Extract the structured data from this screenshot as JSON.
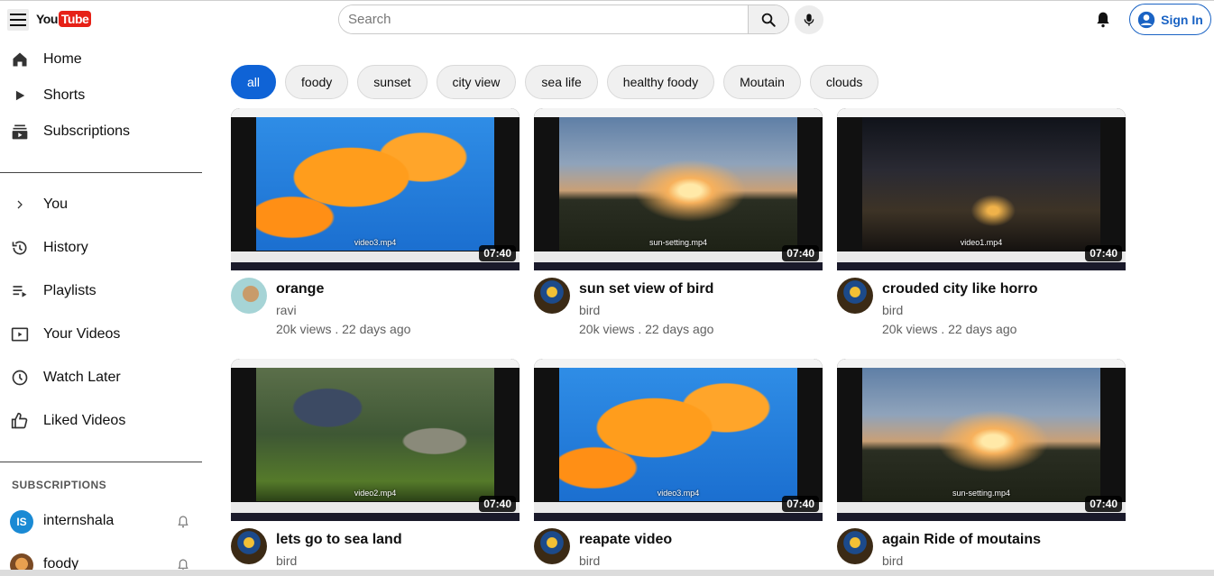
{
  "header": {
    "logo_you": "You",
    "logo_tube": "Tube",
    "search_placeholder": "Search",
    "signin_label": "Sign In"
  },
  "sidebar": {
    "main": [
      {
        "label": "Home",
        "icon": "home-icon"
      },
      {
        "label": "Shorts",
        "icon": "play-icon"
      },
      {
        "label": "Subscriptions",
        "icon": "subscriptions-icon"
      }
    ],
    "you": [
      {
        "label": "You",
        "icon": "chevron-right-icon"
      },
      {
        "label": "History",
        "icon": "history-icon"
      },
      {
        "label": "Playlists",
        "icon": "playlist-icon"
      },
      {
        "label": "Your Videos",
        "icon": "video-icon"
      },
      {
        "label": "Watch Later",
        "icon": "clock-icon"
      },
      {
        "label": "Liked Videos",
        "icon": "thumbs-up-icon"
      }
    ],
    "subscriptions_heading": "SUBSCRIPTIONS",
    "subscriptions": [
      {
        "name": "internshala",
        "initials": "IS",
        "color": "#1a8ad4"
      },
      {
        "name": "foody",
        "initials": "",
        "color": "#c98a4a"
      }
    ]
  },
  "chips": [
    "all",
    "foody",
    "sunset",
    "city view",
    "sea life",
    "healthy foody",
    "Moutain",
    "clouds"
  ],
  "videos": [
    {
      "title": "orange",
      "channel": "ravi",
      "stats": "20k views . 22 days ago",
      "duration": "07:40",
      "file": "video3.mp4"
    },
    {
      "title": "sun set view of bird",
      "channel": "bird",
      "stats": "20k views . 22 days ago",
      "duration": "07:40",
      "file": "sun-setting.mp4"
    },
    {
      "title": "crouded city like horro",
      "channel": "bird",
      "stats": "20k views . 22 days ago",
      "duration": "07:40",
      "file": "video1.mp4"
    },
    {
      "title": "lets go to sea land",
      "channel": "bird",
      "stats": "",
      "duration": "07:40",
      "file": "video2.mp4"
    },
    {
      "title": "reapate video",
      "channel": "bird",
      "stats": "",
      "duration": "07:40",
      "file": "video3.mp4"
    },
    {
      "title": "again Ride of moutains",
      "channel": "bird",
      "stats": "",
      "duration": "07:40",
      "file": "sun-setting.mp4"
    }
  ],
  "colors": {
    "accent": "#0f63d6",
    "signin": "#1a63c4",
    "logo_red": "#e62117"
  }
}
